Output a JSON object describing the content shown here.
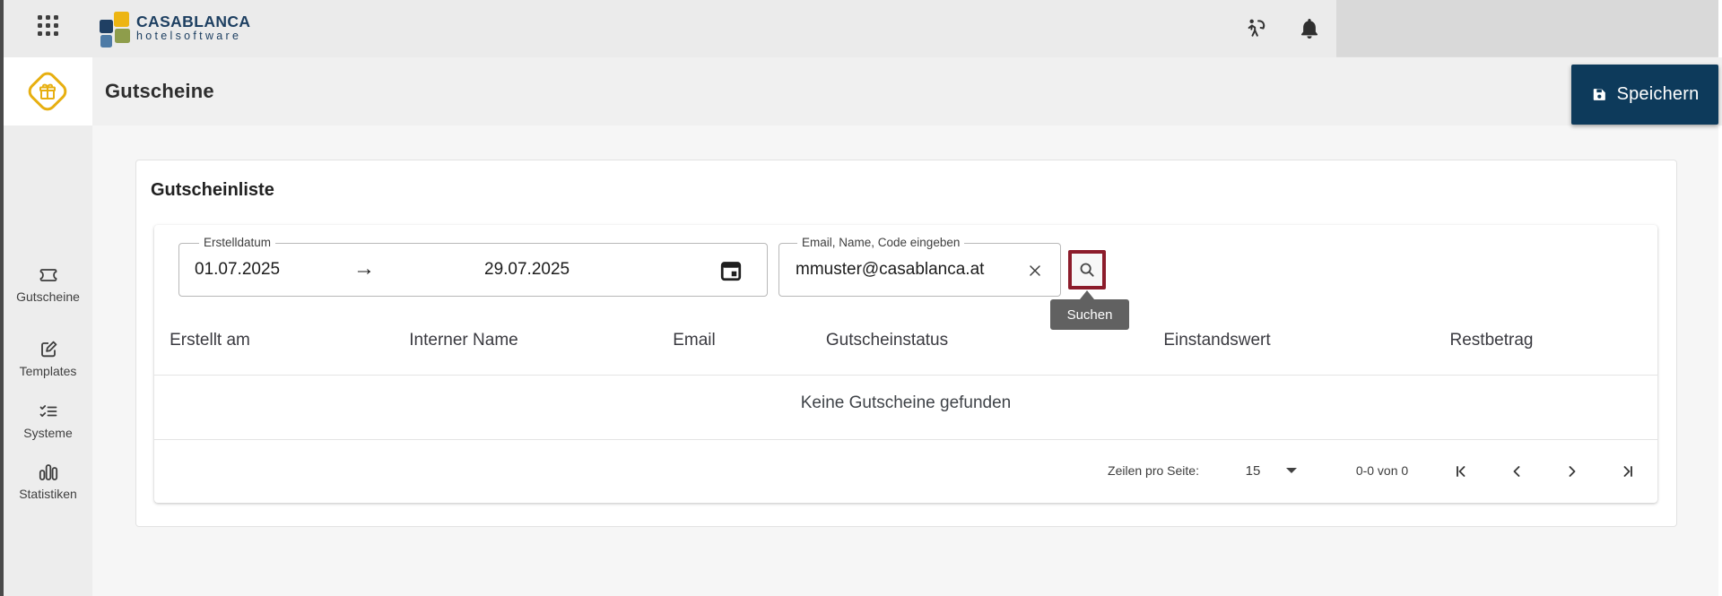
{
  "topbar": {
    "logo": {
      "title": "CASABLANCA",
      "subtitle": "hotelsoftware"
    }
  },
  "header": {
    "title": "Gutscheine",
    "save_label": "Speichern"
  },
  "sidebar": {
    "items": [
      {
        "label": "Gutscheine",
        "icon": "ticket-icon"
      },
      {
        "label": "Templates",
        "icon": "edit-icon"
      },
      {
        "label": "Systeme",
        "icon": "checklist-icon"
      },
      {
        "label": "Statistiken",
        "icon": "bar-chart-icon"
      }
    ]
  },
  "voucher_list": {
    "title": "Gutscheinliste",
    "filters": {
      "date_label": "Erstelldatum",
      "date_from": "01.07.2025",
      "date_to": "29.07.2025",
      "range_arrow": "→",
      "search_label": "Email, Name, Code eingeben",
      "search_value": "mmuster@casablanca.at",
      "search_tooltip": "Suchen"
    },
    "table": {
      "columns": [
        "Erstellt am",
        "Interner Name",
        "Email",
        "Gutscheinstatus",
        "Einstandswert",
        "Restbetrag"
      ],
      "empty_message": "Keine Gutscheine gefunden"
    },
    "pagination": {
      "rows_per_page_label": "Zeilen pro Seite:",
      "rows_per_page": "15",
      "range_label": "0-0 von 0"
    }
  },
  "colors": {
    "accent_navy": "#0d3a5b",
    "search_focus_red": "#8c1c2b",
    "brand_yellow": "#e7af10",
    "tooltip_gray": "#616161",
    "topbar_gray": "#ebebeb"
  }
}
